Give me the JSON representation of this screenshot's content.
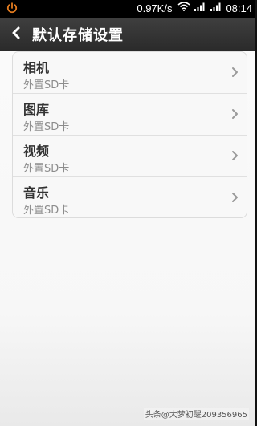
{
  "statusbar": {
    "net_speed": "0.97K/s",
    "time": "08:14"
  },
  "header": {
    "title": "默认存储设置"
  },
  "items": [
    {
      "title": "相机",
      "subtitle": "外置SD卡"
    },
    {
      "title": "图库",
      "subtitle": "外置SD卡"
    },
    {
      "title": "视频",
      "subtitle": "外置SD卡"
    },
    {
      "title": "音乐",
      "subtitle": "外置SD卡"
    }
  ],
  "watermark": "头条@大梦初醒209356965",
  "colors": {
    "statusbar": "#000000",
    "header": "#333333",
    "background": "#f7f7f7",
    "power_icon": "#e07a1f"
  }
}
